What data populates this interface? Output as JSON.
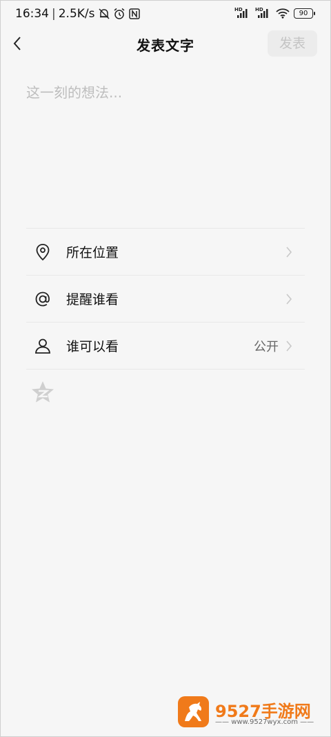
{
  "status_bar": {
    "time": "16:34",
    "network_speed": "2.5K/s",
    "battery_level": "90",
    "hd_label": "HD",
    "icons": [
      "mute-bell-icon",
      "alarm-icon",
      "nfc-icon",
      "signal-icon",
      "signal-icon",
      "wifi-icon",
      "battery-icon"
    ]
  },
  "header": {
    "title": "发表文字",
    "publish_label": "发表",
    "back_icon": "chevron-left-icon"
  },
  "compose": {
    "placeholder": "这一刻的想法..."
  },
  "options": [
    {
      "label": "所在位置",
      "icon": "location-pin-icon",
      "value": ""
    },
    {
      "label": "提醒谁看",
      "icon": "at-sign-icon",
      "value": ""
    },
    {
      "label": "谁可以看",
      "icon": "person-icon",
      "value": "公开"
    }
  ],
  "qzone_icon": "qzone-star-icon",
  "watermark": {
    "brand": "9527手游网",
    "url": "www.9527wyx.com"
  },
  "colors": {
    "background": "#f6f6f6",
    "publish_disabled_bg": "#ececec",
    "publish_disabled_text": "#c4c4c4",
    "placeholder": "#bdbdbd",
    "watermark_orange": "#f07a1a"
  }
}
